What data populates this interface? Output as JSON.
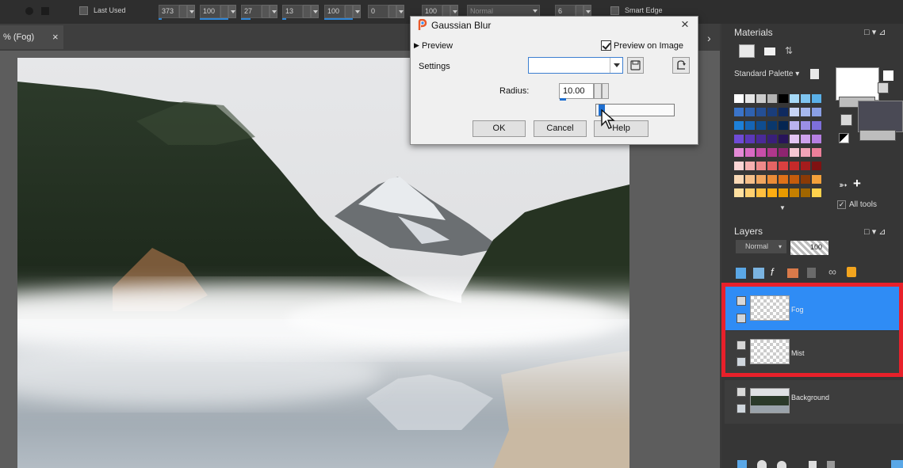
{
  "toolbar": {
    "preset_label": "Last Used",
    "size": "373",
    "hardness": "100",
    "step": "27",
    "density": "13",
    "thickness": "100",
    "rotation": "0",
    "opacity": "100",
    "blend_mode": "Normal",
    "tolerance": "6",
    "smart_edge_label": "Smart Edge"
  },
  "document_tab": {
    "label": "% (Fog)",
    "close": "×"
  },
  "dialog": {
    "title": "Gaussian Blur",
    "close": "×",
    "preview_label": "Preview",
    "preview_on_image_label": "Preview on Image",
    "preview_on_image_checked": true,
    "settings_label": "Settings",
    "settings_value": "",
    "radius_label": "Radius:",
    "radius_value": "10.00",
    "ok_label": "OK",
    "cancel_label": "Cancel",
    "help_label": "Help"
  },
  "materials": {
    "title": "Materials",
    "palette_label": "Standard Palette",
    "all_tools_label": "All tools",
    "all_tools_checked": true,
    "foreground_color": "#ffffff",
    "background_color": "#4a4a55"
  },
  "layers": {
    "title": "Layers",
    "blend_mode": "Normal",
    "opacity": "100",
    "items": [
      {
        "name": "Fog",
        "selected": true
      },
      {
        "name": "Mist",
        "selected": false
      },
      {
        "name": "Background",
        "selected": false
      }
    ]
  },
  "colors": {
    "selection_blue": "#2f8cf5",
    "highlight_red": "#e8202a",
    "accent": "#1f6fd0"
  }
}
